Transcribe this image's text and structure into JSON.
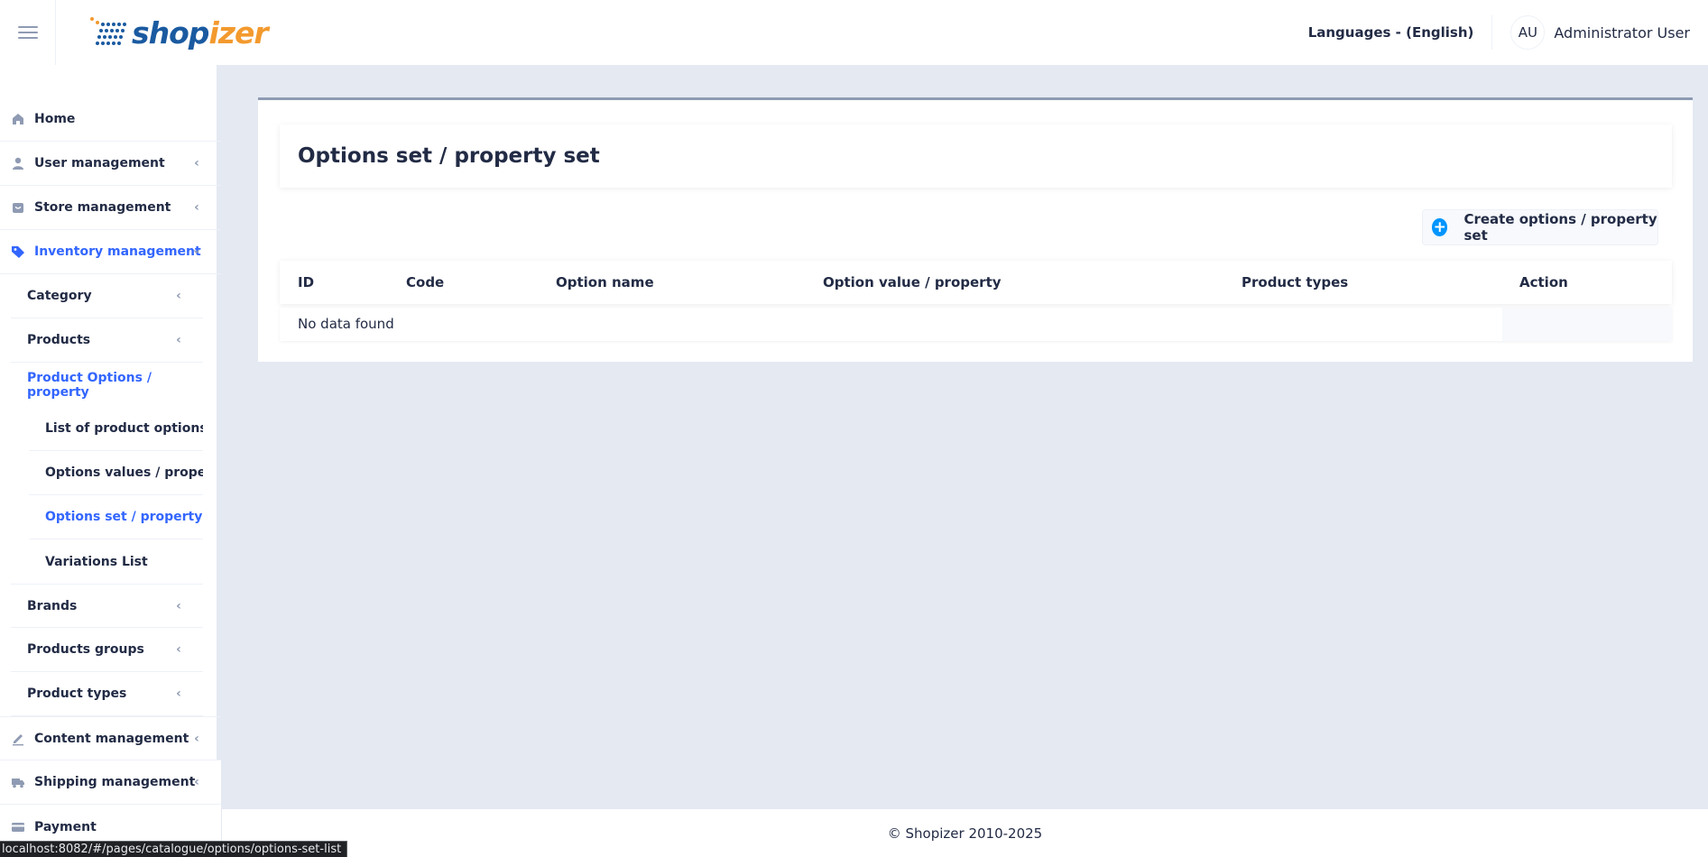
{
  "header": {
    "logo_text_a": "shop",
    "logo_text_b": "izer",
    "language": "Languages - (English)",
    "avatar_initials": "AU",
    "user_name": "Administrator User"
  },
  "sidebar": {
    "home": "Home",
    "user_management": "User management",
    "store_management": "Store management",
    "inventory_management": "Inventory management",
    "category": "Category",
    "products": "Products",
    "product_options": "Product Options / property",
    "list_options": "List of product options / property",
    "options_values": "Options values / property values",
    "options_set": "Options set / property set",
    "variations": "Variations List",
    "brands": "Brands",
    "products_groups": "Products groups",
    "product_types": "Product types",
    "content_management": "Content management",
    "shipping_management": "Shipping management",
    "payment": "Payment"
  },
  "main": {
    "title": "Options set / property set",
    "create_button": "Create options / property set",
    "columns": [
      "ID",
      "Code",
      "Option name",
      "Option value / property",
      "Product types",
      "Action"
    ],
    "empty_message": "No data found"
  },
  "footer": {
    "copyright": "© Shopizer 2010-2025"
  },
  "status_bar": {
    "url": "localhost:8082/#/pages/catalogue/options/options-set-list"
  },
  "colors": {
    "accent": "#3366ff",
    "accent_light": "#598bff",
    "background": "#e4e9f2",
    "logo_blue": "#1a5aa0",
    "logo_orange": "#f39a2e",
    "plus_blue": "#0095ff"
  }
}
